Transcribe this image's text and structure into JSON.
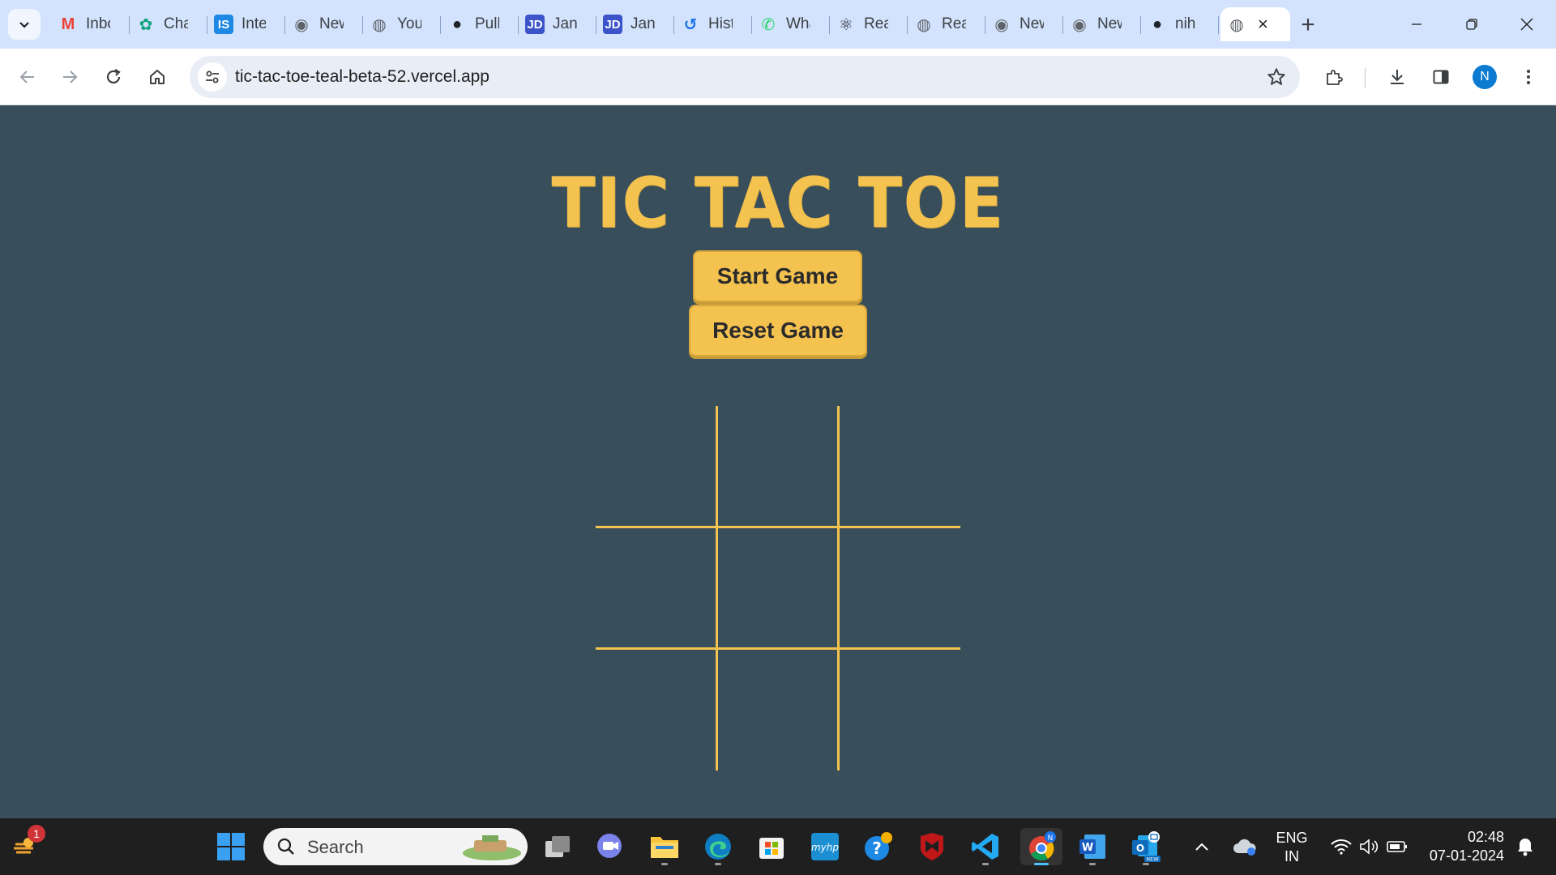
{
  "browser": {
    "tabs": [
      {
        "title": "Inbox",
        "icon": "gmail-icon",
        "color": "#ea4335"
      },
      {
        "title": "ChatGPT",
        "icon": "chatgpt-icon",
        "color": "#10a37f"
      },
      {
        "title": "Interview",
        "icon": "is-icon",
        "color": "#1e88e5"
      },
      {
        "title": "New Tab",
        "icon": "chrome-icon",
        "color": "#5f6368"
      },
      {
        "title": "YouTube",
        "icon": "globe-icon",
        "color": "#5f6368"
      },
      {
        "title": "Pull",
        "icon": "github-icon",
        "color": "#1f2328"
      },
      {
        "title": "Jan",
        "icon": "jd-icon",
        "color": "#3d53c9"
      },
      {
        "title": "Jan",
        "icon": "jd-icon",
        "color": "#3d53c9"
      },
      {
        "title": "History",
        "icon": "history-icon",
        "color": "#1a73e8"
      },
      {
        "title": "WhatsApp",
        "icon": "whatsapp-icon",
        "color": "#25d366"
      },
      {
        "title": "React",
        "icon": "react-icon",
        "color": "#20232a"
      },
      {
        "title": "React",
        "icon": "globe-icon",
        "color": "#5f6368"
      },
      {
        "title": "New Tab",
        "icon": "chrome-icon",
        "color": "#5f6368"
      },
      {
        "title": "New Tab",
        "icon": "chrome-icon",
        "color": "#5f6368"
      },
      {
        "title": "nih",
        "icon": "github-icon",
        "color": "#1f2328"
      }
    ],
    "active_tab_icon": "globe-icon",
    "url": "tic-tac-toe-teal-beta-52.vercel.app",
    "profile_initial": "N"
  },
  "game": {
    "title": "TIC TAC TOE",
    "start_label": "Start Game",
    "reset_label": "Reset Game",
    "board": [
      "",
      "",
      "",
      "",
      "",
      "",
      "",
      "",
      ""
    ],
    "colors": {
      "background": "#384f5b",
      "accent": "#f3c24f"
    }
  },
  "taskbar": {
    "search_placeholder": "Search",
    "notification_count": "1",
    "language": "ENG",
    "region": "IN",
    "time": "02:48",
    "date": "07-01-2024"
  }
}
